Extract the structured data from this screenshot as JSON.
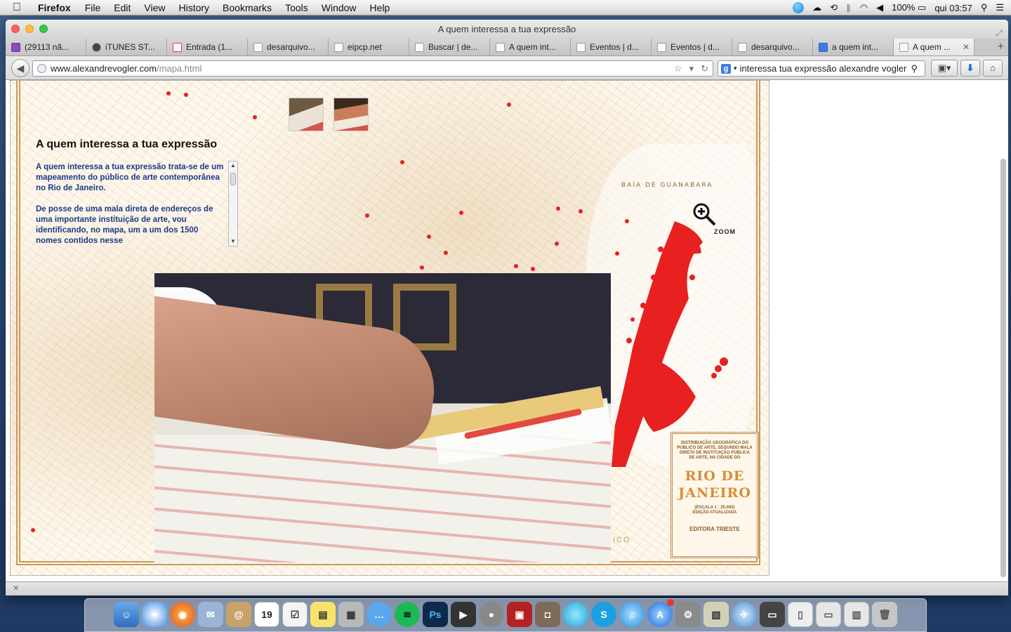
{
  "menubar": {
    "app": "Firefox",
    "items": [
      "File",
      "Edit",
      "View",
      "History",
      "Bookmarks",
      "Tools",
      "Window",
      "Help"
    ],
    "battery": "100%",
    "clock": "qui 03:57"
  },
  "window": {
    "title": "A quem interessa a tua expressão"
  },
  "tabs": [
    {
      "label": "(29113 nã...",
      "icon": "mail-icon"
    },
    {
      "label": "iTUNES ST...",
      "icon": "apple-icon"
    },
    {
      "label": "Entrada (1...",
      "icon": "gmail-icon"
    },
    {
      "label": "desarquivo...",
      "icon": "page-icon"
    },
    {
      "label": "eipcp.net",
      "icon": "page-icon"
    },
    {
      "label": "Buscar | de...",
      "icon": "page-icon"
    },
    {
      "label": "A quem int...",
      "icon": "page-icon"
    },
    {
      "label": "Eventos | d...",
      "icon": "page-icon"
    },
    {
      "label": "Eventos | d...",
      "icon": "page-icon"
    },
    {
      "label": "desarquivo...",
      "icon": "page-icon"
    },
    {
      "label": "a quem int...",
      "icon": "google-icon"
    },
    {
      "label": "A quem ...",
      "icon": "page-icon",
      "active": true
    }
  ],
  "navbar": {
    "url_host": "www.alexandrevogler.com",
    "url_path": "/mapa.html",
    "search_value": "interessa tua expressão alexandre vogler"
  },
  "page": {
    "title": "A quem interessa a tua expressão",
    "paragraph1": "A quem interessa a tua expressão trata-se de um mapeamento do público de arte contemporânea no Rio de Janeiro.",
    "paragraph2": "De posse de uma mala direta de endereços de uma importante instituição de arte, vou identificando, no mapa, um a um dos 1500 nomes contidos nesse",
    "zoom_label": "ZOOM",
    "bay_label": "BAÍA DE GUANABARA",
    "map_partial_label": "ICO",
    "legend": {
      "description": "DISTRIBUIÇÃO GEOGRÁFICA DO PÚBLICO DE ARTE, SEGUNDO MALA DIRETA DE INSTITUIÇÃO PÚBLICA DE ARTE, NA CIDADE DO",
      "city_line1": "RIO DE",
      "city_line2": "JANEIRO",
      "scale": "(ESCALA 1 : 25.000)",
      "edition": "EDIÇÃO ATUALIZADA",
      "publisher": "EDITORA TRIESTE"
    }
  },
  "calendar_day": "19",
  "colors": {
    "map_text_blue": "#1d3a8a",
    "dot_red": "#e82020",
    "map_brown": "#c99a5c"
  }
}
